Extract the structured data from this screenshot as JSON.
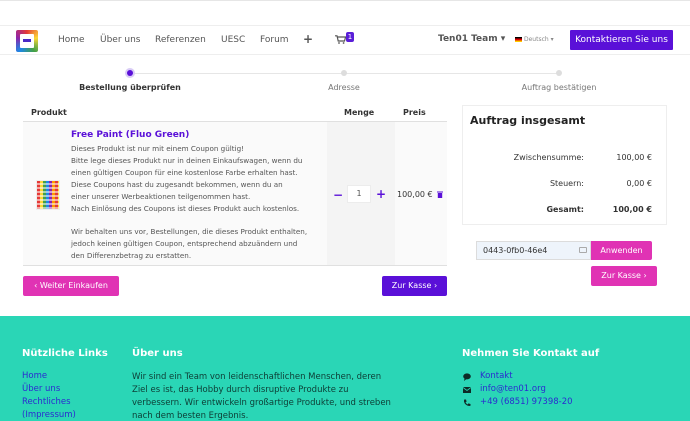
{
  "nav": {
    "links": [
      "Home",
      "Über uns",
      "Referenzen",
      "UESC",
      "Forum"
    ],
    "plus": "+",
    "cart_count": "1",
    "team": "Ten01 Team ▾",
    "language": "Deutsch ▾",
    "contact": "Kontaktieren Sie uns"
  },
  "steps": [
    "Bestellung überprüfen",
    "Adresse",
    "Auftrag bestätigen"
  ],
  "table": {
    "headers": [
      "Produkt",
      "Menge",
      "Preis"
    ],
    "product": {
      "title": "Free Paint (Fluo Green)",
      "description_1": "Dieses Produkt ist nur mit einem Coupon gültig!\nBitte lege dieses Produkt nur in deinen Einkaufswagen, wenn du\neinen gültigen Coupon für eine kostenlose Farbe erhalten hast.\nDiese Coupons hast du zugesandt bekommen, wenn du an\neiner unserer Werbeaktionen teilgenommen hast.\nNach Einlösung des Coupons ist dieses Produkt auch kostenlos.",
      "description_2": "Wir behalten uns vor, Bestellungen, die dieses Produkt enthalten,\njedoch keinen gültigen Coupon, entsprechend abzuändern und\nden Differenzbetrag zu erstatten.",
      "quantity": "1",
      "minus": "−",
      "plus": "+",
      "price": "100,00 €"
    }
  },
  "summary": {
    "title": "Auftrag insgesamt",
    "subtotal_label": "Zwischensumme:",
    "subtotal": "100,00 €",
    "tax_label": "Steuern:",
    "tax": "0,00 €",
    "total_label": "Gesamt:",
    "total": "100,00 €",
    "coupon_value": "0443-0fb0-46e4",
    "apply": "Anwenden",
    "checkout": "Zur Kasse ›"
  },
  "buttons": {
    "continue": "‹ Weiter Einkaufen",
    "checkout": "Zur Kasse ›"
  },
  "footer": {
    "links_heading": "Nützliche Links",
    "links": [
      "Home",
      "Über uns",
      "Rechtliches",
      "(Impressum)"
    ],
    "about_heading": "Über uns",
    "about_text": "Wir sind ein Team von leidenschaftlichen Menschen, deren Ziel es ist, das Hobby durch disruptive Produkte zu verbessern. Wir entwickeln großartige Produkte, und streben nach dem besten Ergebnis.",
    "contact_heading": "Nehmen Sie Kontakt auf",
    "contact_items": [
      "Kontakt",
      "info@ten01.org",
      "+49 (6851) 97398-20"
    ]
  },
  "colors": {
    "primary": "#5a10d8",
    "accent": "#e033b4",
    "footer": "#2ad6b6"
  }
}
